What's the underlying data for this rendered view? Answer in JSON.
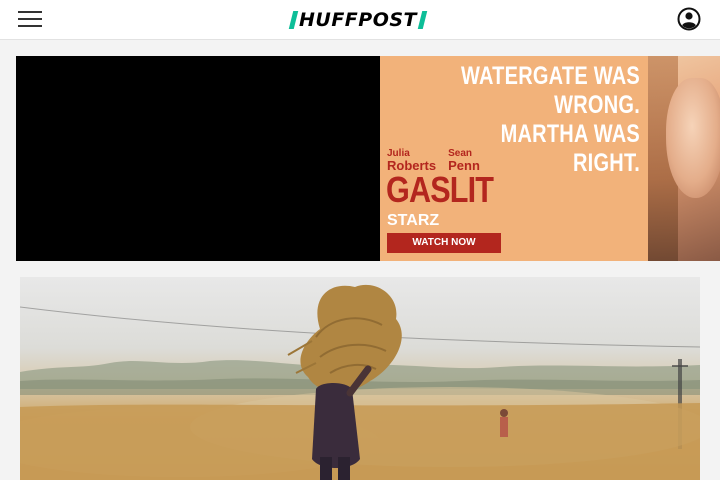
{
  "header": {
    "logo_text": "HUFFPOST",
    "menu_icon": "hamburger-menu-icon",
    "user_icon": "user-account-icon",
    "brand_color": "#0dbe98"
  },
  "ad": {
    "headline_line1": "WATERGATE WAS",
    "headline_line2": "WRONG.",
    "headline_line3": "MARTHA WAS",
    "headline_line4": "RIGHT.",
    "actor1_first": "Julia",
    "actor1_last": "Roberts",
    "actor2_first": "Sean",
    "actor2_last": "Penn",
    "show_title": "GASLIT",
    "network": "STARZ",
    "cta_label": "WATCH NOW",
    "panel_color": "#f2b27a",
    "accent_color": "#b3261e"
  },
  "hero_image": {
    "subject": "farm worker carrying a bundle of harvested wheat across a dusty field"
  }
}
